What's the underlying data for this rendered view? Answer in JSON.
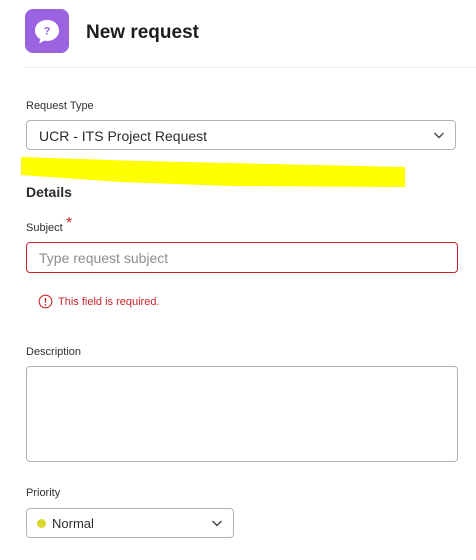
{
  "header": {
    "title": "New request",
    "app_icon": "chat-bubble-question-icon",
    "icon_glyph": "?",
    "icon_color": "#9b63e0"
  },
  "request_type": {
    "label": "Request Type",
    "selected": "UCR - ITS Project Request",
    "chevron_icon": "chevron-down-icon"
  },
  "details": {
    "section_title": "Details",
    "subject": {
      "label": "Subject",
      "required_mark": "*",
      "value": "",
      "placeholder": "Type request subject",
      "error": "This field is required.",
      "error_icon": "alert-circle-icon"
    },
    "description": {
      "label": "Description",
      "value": ""
    },
    "priority": {
      "label": "Priority",
      "selected": "Normal",
      "status_color": "#d9d92b",
      "chevron_icon": "chevron-down-icon"
    }
  },
  "colors": {
    "error": "#c9252c",
    "highlight": "#ffff00",
    "border": "#b3b3b3"
  }
}
